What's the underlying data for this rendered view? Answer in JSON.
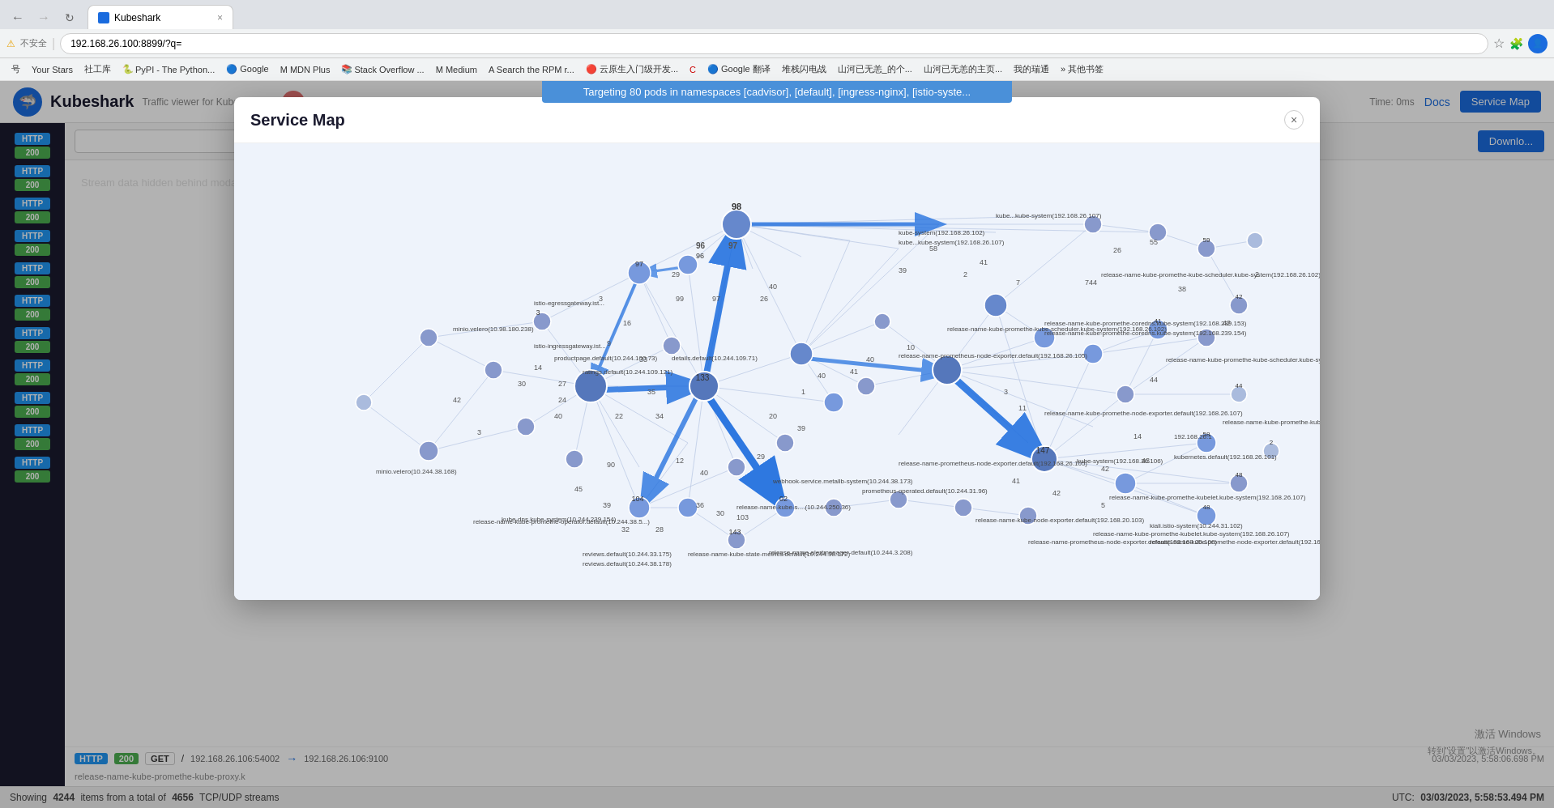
{
  "browser": {
    "address": "192.168.26.100:8899/?q=",
    "tab_label": "Kubeshark",
    "bookmarks": [
      "号",
      "Your Stars",
      "社工库",
      "PyPI - The Python...",
      "Google",
      "MDN Plus",
      "Stack Overflow...",
      "Medium",
      "Search the RPM r...",
      "云原生入门级开发...",
      "Google 翻译",
      "堆栈闪电战",
      "山河已无恙_的个...",
      "山河已无恙的主页...",
      "我的瑞通",
      "其他书签"
    ]
  },
  "kubeshark": {
    "title": "Kubeshark",
    "subtitle": "Traffic viewer for Kubernetes",
    "docs_label": "Docs",
    "service_map_label": "Service Map"
  },
  "alert": {
    "text": "Targeting 80 pods in namespaces [cadvisor], [default], [ingress-nginx], [istio-syste..."
  },
  "header": {
    "time_label": "Time: 0ms"
  },
  "toolbar": {
    "download_label": "Downlo..."
  },
  "sidebar": {
    "items": [
      {
        "method": "HTTP",
        "status": "200"
      },
      {
        "method": "HTTP",
        "status": "200"
      },
      {
        "method": "HTTP",
        "status": "200"
      },
      {
        "method": "HTTP",
        "status": "200"
      },
      {
        "method": "HTTP",
        "status": "200"
      },
      {
        "method": "HTTP",
        "status": "200"
      },
      {
        "method": "HTTP",
        "status": "200"
      },
      {
        "method": "HTTP",
        "status": "200"
      },
      {
        "method": "HTTP",
        "status": "200"
      },
      {
        "method": "HTTP",
        "status": "200"
      },
      {
        "method": "HTTP",
        "status": "200"
      }
    ]
  },
  "stream": {
    "last_row": {
      "method": "GET",
      "path": "/",
      "src": "192.168.26.106:54002",
      "arrow": "→",
      "dst": "192.168.26.106:9100",
      "time": "03/03/2023, 5:58:06.698 PM",
      "service": "release-name-kube-promethe-kube-proxy.k"
    }
  },
  "statusbar": {
    "items_text": "Showing",
    "items_count": "4244",
    "items_middle": "items from a total of",
    "total_count": "4656",
    "stream_type": "TCP/UDP streams",
    "utc_label": "UTC:",
    "utc_time": "03/03/2023, 5:58:53.494 PM"
  },
  "modal": {
    "title": "Service Map",
    "close_label": "×"
  },
  "windows": {
    "activate": "激活 Windows",
    "settings": "转到\"设置\"以激活Windows。"
  }
}
